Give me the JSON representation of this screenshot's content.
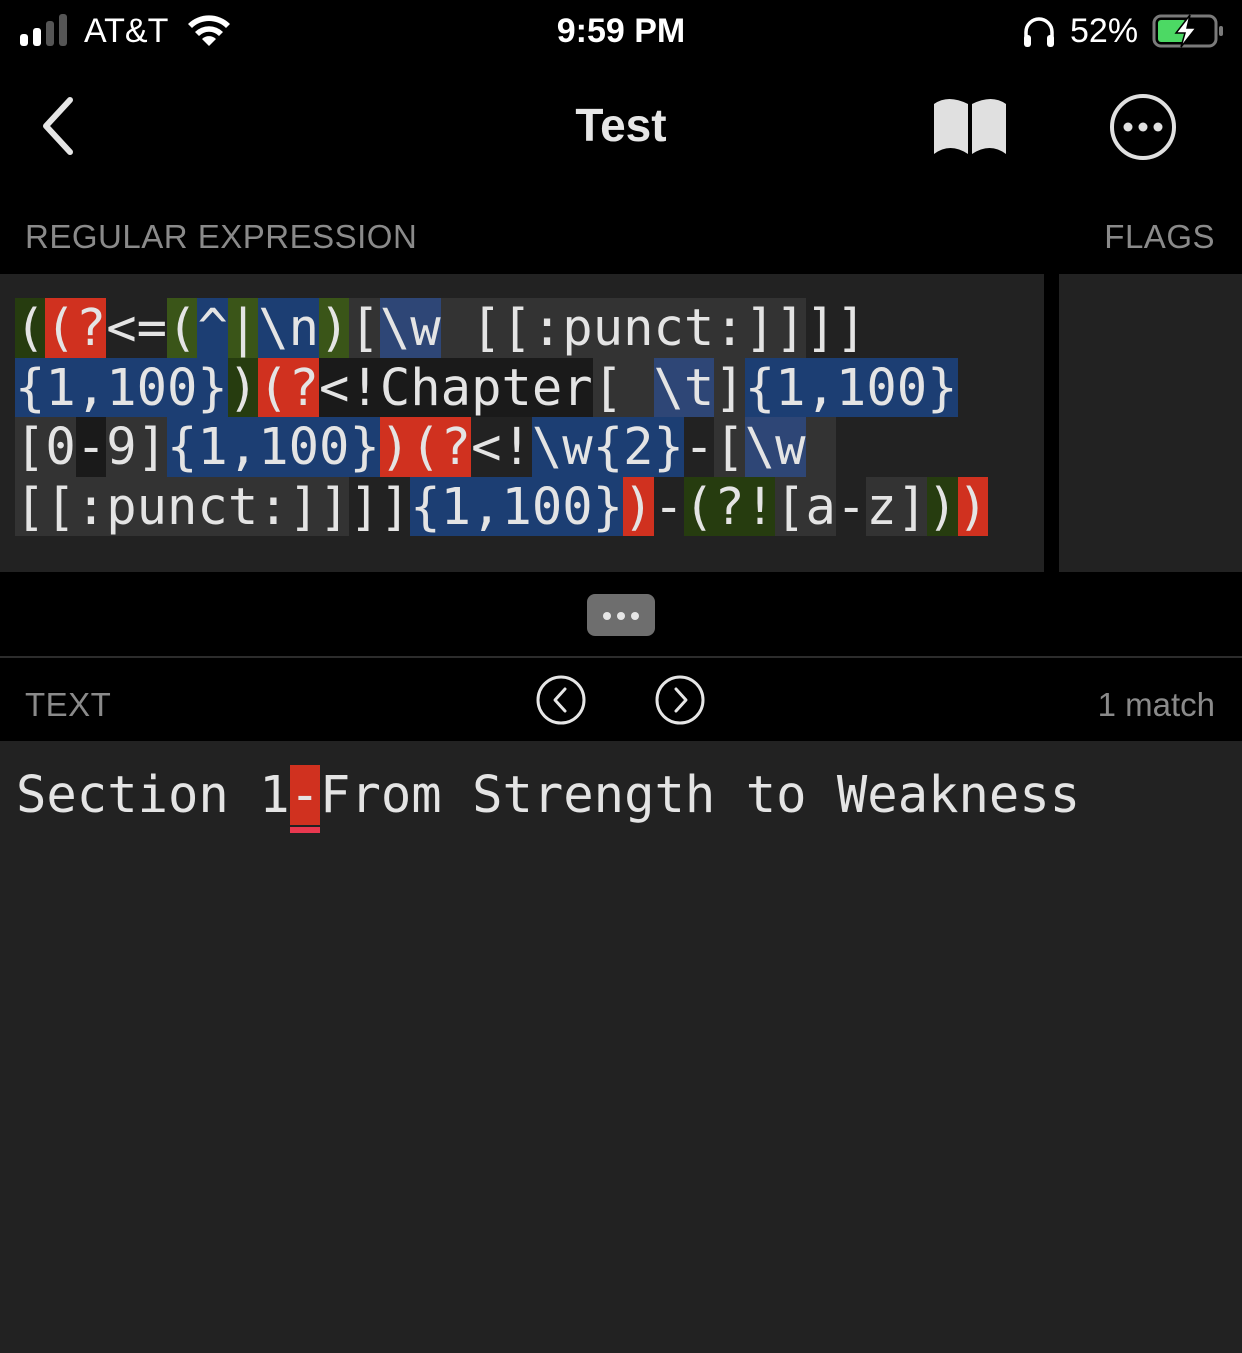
{
  "status_bar": {
    "carrier": "AT&T",
    "time": "9:59 PM",
    "battery_percent": "52%",
    "battery_level": 0.52,
    "charging": true,
    "signal_bars_active": 2,
    "signal_bars_total": 4,
    "icons": [
      "signal-icon",
      "wifi-icon",
      "headphones-icon",
      "battery-charging-icon"
    ]
  },
  "navbar": {
    "title": "Test",
    "back_icon": "chevron-left-icon",
    "book_icon": "book-icon",
    "more_icon": "ellipsis-circle-icon"
  },
  "regex_section": {
    "label": "REGULAR EXPRESSION",
    "flags_label": "FLAGS",
    "flags_value": "",
    "expression": "((?<=(^|\\n)[\\w [[:punct:]]]{1,100})(?<!Chapter[ \\t]{1,100}[0-9]{1,100})(?<!\\w{2}-[\\w [[:punct:]]]{1,100})-(?![a-z]))",
    "lines": [
      [
        {
          "t": "(",
          "c": "green"
        },
        {
          "t": "(?",
          "c": "red"
        },
        {
          "t": "<=",
          "c": "plain"
        },
        {
          "t": "(",
          "c": "lgreen"
        },
        {
          "t": "^",
          "c": "blue"
        },
        {
          "t": "|",
          "c": "lgreen"
        },
        {
          "t": "\\n",
          "c": "blue"
        },
        {
          "t": ")",
          "c": "lgreen"
        },
        {
          "t": "[",
          "c": "gray"
        },
        {
          "t": "\\w",
          "c": "lblue"
        },
        {
          "t": " [[:punct:]]",
          "c": "gray"
        },
        {
          "t": "]]",
          "c": "plain"
        }
      ],
      [
        {
          "t": "{1,100}",
          "c": "blue"
        },
        {
          "t": ")",
          "c": "green"
        },
        {
          "t": "(?",
          "c": "red"
        },
        {
          "t": "<!Chapter",
          "c": "dark"
        },
        {
          "t": "[ ",
          "c": "gray"
        },
        {
          "t": "\\t",
          "c": "lblue"
        },
        {
          "t": "]",
          "c": "gray"
        },
        {
          "t": "{1,100}",
          "c": "blue"
        }
      ],
      [
        {
          "t": "[0",
          "c": "gray"
        },
        {
          "t": "-",
          "c": "dark"
        },
        {
          "t": "9]",
          "c": "gray"
        },
        {
          "t": "{1,100}",
          "c": "blue"
        },
        {
          "t": ")(?",
          "c": "red"
        },
        {
          "t": "<!",
          "c": "plain"
        },
        {
          "t": "\\w{2}",
          "c": "blue"
        },
        {
          "t": "-",
          "c": "plain"
        },
        {
          "t": "[",
          "c": "gray"
        },
        {
          "t": "\\w",
          "c": "lblue"
        },
        {
          "t": " ",
          "c": "gray"
        }
      ],
      [
        {
          "t": "[[:punct:]]",
          "c": "gray"
        },
        {
          "t": "]]",
          "c": "plain"
        },
        {
          "t": "{1,100}",
          "c": "blue"
        },
        {
          "t": ")",
          "c": "red"
        },
        {
          "t": "-",
          "c": "plain"
        },
        {
          "t": "(?!",
          "c": "green"
        },
        {
          "t": "[a",
          "c": "gray"
        },
        {
          "t": "-",
          "c": "plain"
        },
        {
          "t": "z]",
          "c": "gray"
        },
        {
          "t": ")",
          "c": "green"
        },
        {
          "t": ")",
          "c": "red"
        }
      ]
    ]
  },
  "splitter": {
    "handle_icon": "ellipsis-icon"
  },
  "text_section": {
    "label": "TEXT",
    "prev_icon": "chevron-left-circle-icon",
    "next_icon": "chevron-right-circle-icon",
    "match_count": "1 match",
    "text_before": "Section 1",
    "match_text": "-",
    "text_after": "From Strength to Weakness"
  },
  "colors": {
    "red": "#d0311f",
    "green": "#263c0f",
    "lgreen": "#3a5518",
    "blue": "#1c3e73",
    "lblue": "#2e4676",
    "gray": "#333333",
    "dark": "#1a1a1a",
    "battery_green": "#4cd964",
    "label_gray": "#8a8a8a"
  }
}
